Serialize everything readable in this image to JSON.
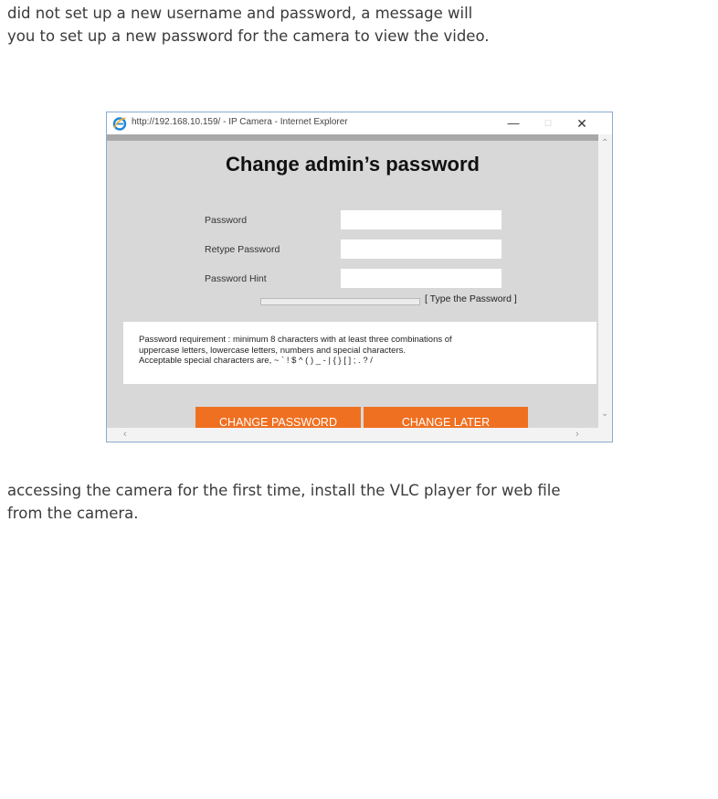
{
  "doc": {
    "top_lines": [
      "did not set up a new username and password, a message will",
      " you to set up a new password for the camera to view the video."
    ],
    "bottom_lines": [
      "accessing the camera for the first time, install the VLC player for web file",
      "from the camera."
    ]
  },
  "window": {
    "title": "http://192.168.10.159/ - IP Camera - Internet Explorer",
    "minimize": "—",
    "maximize": "☐",
    "close": "✕"
  },
  "page": {
    "heading": "Change admin’s password",
    "fields": {
      "password_label": "Password",
      "retype_label": "Retype Password",
      "hint_label": "Password Hint"
    },
    "strength_text": "[ Type the Password ]",
    "requirement_lines": [
      "Password requirement : minimum 8 characters with at least three combinations of",
      "uppercase letters, lowercase letters, numbers and special characters.",
      "Acceptable special characters are, ~ ` ! $ ^ ( ) _ - | { } [ ] ; . ? /"
    ],
    "change_password_button": "CHANGE PASSWORD",
    "change_later_button": "CHANGE LATER"
  },
  "scroll": {
    "up": "⌃",
    "down": "⌄",
    "left": "‹",
    "right": "›"
  },
  "colors": {
    "accent": "#f07021",
    "content_bg": "#d8d8d8",
    "window_border": "#8aa9cf"
  },
  "icons": {
    "browser": "internet-explorer-icon"
  }
}
